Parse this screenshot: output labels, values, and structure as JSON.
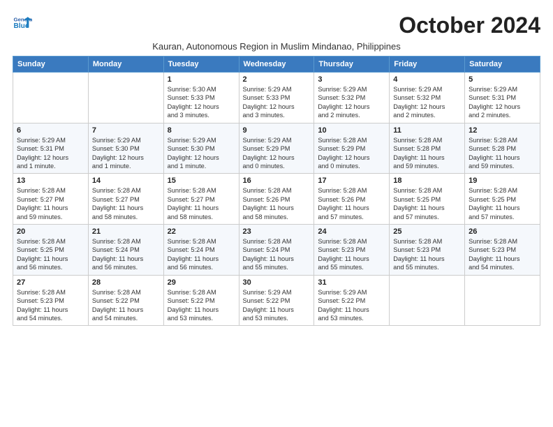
{
  "header": {
    "logo_general": "General",
    "logo_blue": "Blue",
    "month_title": "October 2024",
    "subtitle": "Kauran, Autonomous Region in Muslim Mindanao, Philippines"
  },
  "weekdays": [
    "Sunday",
    "Monday",
    "Tuesday",
    "Wednesday",
    "Thursday",
    "Friday",
    "Saturday"
  ],
  "weeks": [
    [
      {
        "day": "",
        "info": ""
      },
      {
        "day": "",
        "info": ""
      },
      {
        "day": "1",
        "info": "Sunrise: 5:30 AM\nSunset: 5:33 PM\nDaylight: 12 hours\nand 3 minutes."
      },
      {
        "day": "2",
        "info": "Sunrise: 5:29 AM\nSunset: 5:33 PM\nDaylight: 12 hours\nand 3 minutes."
      },
      {
        "day": "3",
        "info": "Sunrise: 5:29 AM\nSunset: 5:32 PM\nDaylight: 12 hours\nand 2 minutes."
      },
      {
        "day": "4",
        "info": "Sunrise: 5:29 AM\nSunset: 5:32 PM\nDaylight: 12 hours\nand 2 minutes."
      },
      {
        "day": "5",
        "info": "Sunrise: 5:29 AM\nSunset: 5:31 PM\nDaylight: 12 hours\nand 2 minutes."
      }
    ],
    [
      {
        "day": "6",
        "info": "Sunrise: 5:29 AM\nSunset: 5:31 PM\nDaylight: 12 hours\nand 1 minute."
      },
      {
        "day": "7",
        "info": "Sunrise: 5:29 AM\nSunset: 5:30 PM\nDaylight: 12 hours\nand 1 minute."
      },
      {
        "day": "8",
        "info": "Sunrise: 5:29 AM\nSunset: 5:30 PM\nDaylight: 12 hours\nand 1 minute."
      },
      {
        "day": "9",
        "info": "Sunrise: 5:29 AM\nSunset: 5:29 PM\nDaylight: 12 hours\nand 0 minutes."
      },
      {
        "day": "10",
        "info": "Sunrise: 5:28 AM\nSunset: 5:29 PM\nDaylight: 12 hours\nand 0 minutes."
      },
      {
        "day": "11",
        "info": "Sunrise: 5:28 AM\nSunset: 5:28 PM\nDaylight: 11 hours\nand 59 minutes."
      },
      {
        "day": "12",
        "info": "Sunrise: 5:28 AM\nSunset: 5:28 PM\nDaylight: 11 hours\nand 59 minutes."
      }
    ],
    [
      {
        "day": "13",
        "info": "Sunrise: 5:28 AM\nSunset: 5:27 PM\nDaylight: 11 hours\nand 59 minutes."
      },
      {
        "day": "14",
        "info": "Sunrise: 5:28 AM\nSunset: 5:27 PM\nDaylight: 11 hours\nand 58 minutes."
      },
      {
        "day": "15",
        "info": "Sunrise: 5:28 AM\nSunset: 5:27 PM\nDaylight: 11 hours\nand 58 minutes."
      },
      {
        "day": "16",
        "info": "Sunrise: 5:28 AM\nSunset: 5:26 PM\nDaylight: 11 hours\nand 58 minutes."
      },
      {
        "day": "17",
        "info": "Sunrise: 5:28 AM\nSunset: 5:26 PM\nDaylight: 11 hours\nand 57 minutes."
      },
      {
        "day": "18",
        "info": "Sunrise: 5:28 AM\nSunset: 5:25 PM\nDaylight: 11 hours\nand 57 minutes."
      },
      {
        "day": "19",
        "info": "Sunrise: 5:28 AM\nSunset: 5:25 PM\nDaylight: 11 hours\nand 57 minutes."
      }
    ],
    [
      {
        "day": "20",
        "info": "Sunrise: 5:28 AM\nSunset: 5:25 PM\nDaylight: 11 hours\nand 56 minutes."
      },
      {
        "day": "21",
        "info": "Sunrise: 5:28 AM\nSunset: 5:24 PM\nDaylight: 11 hours\nand 56 minutes."
      },
      {
        "day": "22",
        "info": "Sunrise: 5:28 AM\nSunset: 5:24 PM\nDaylight: 11 hours\nand 56 minutes."
      },
      {
        "day": "23",
        "info": "Sunrise: 5:28 AM\nSunset: 5:24 PM\nDaylight: 11 hours\nand 55 minutes."
      },
      {
        "day": "24",
        "info": "Sunrise: 5:28 AM\nSunset: 5:23 PM\nDaylight: 11 hours\nand 55 minutes."
      },
      {
        "day": "25",
        "info": "Sunrise: 5:28 AM\nSunset: 5:23 PM\nDaylight: 11 hours\nand 55 minutes."
      },
      {
        "day": "26",
        "info": "Sunrise: 5:28 AM\nSunset: 5:23 PM\nDaylight: 11 hours\nand 54 minutes."
      }
    ],
    [
      {
        "day": "27",
        "info": "Sunrise: 5:28 AM\nSunset: 5:23 PM\nDaylight: 11 hours\nand 54 minutes."
      },
      {
        "day": "28",
        "info": "Sunrise: 5:28 AM\nSunset: 5:22 PM\nDaylight: 11 hours\nand 54 minutes."
      },
      {
        "day": "29",
        "info": "Sunrise: 5:28 AM\nSunset: 5:22 PM\nDaylight: 11 hours\nand 53 minutes."
      },
      {
        "day": "30",
        "info": "Sunrise: 5:29 AM\nSunset: 5:22 PM\nDaylight: 11 hours\nand 53 minutes."
      },
      {
        "day": "31",
        "info": "Sunrise: 5:29 AM\nSunset: 5:22 PM\nDaylight: 11 hours\nand 53 minutes."
      },
      {
        "day": "",
        "info": ""
      },
      {
        "day": "",
        "info": ""
      }
    ]
  ]
}
